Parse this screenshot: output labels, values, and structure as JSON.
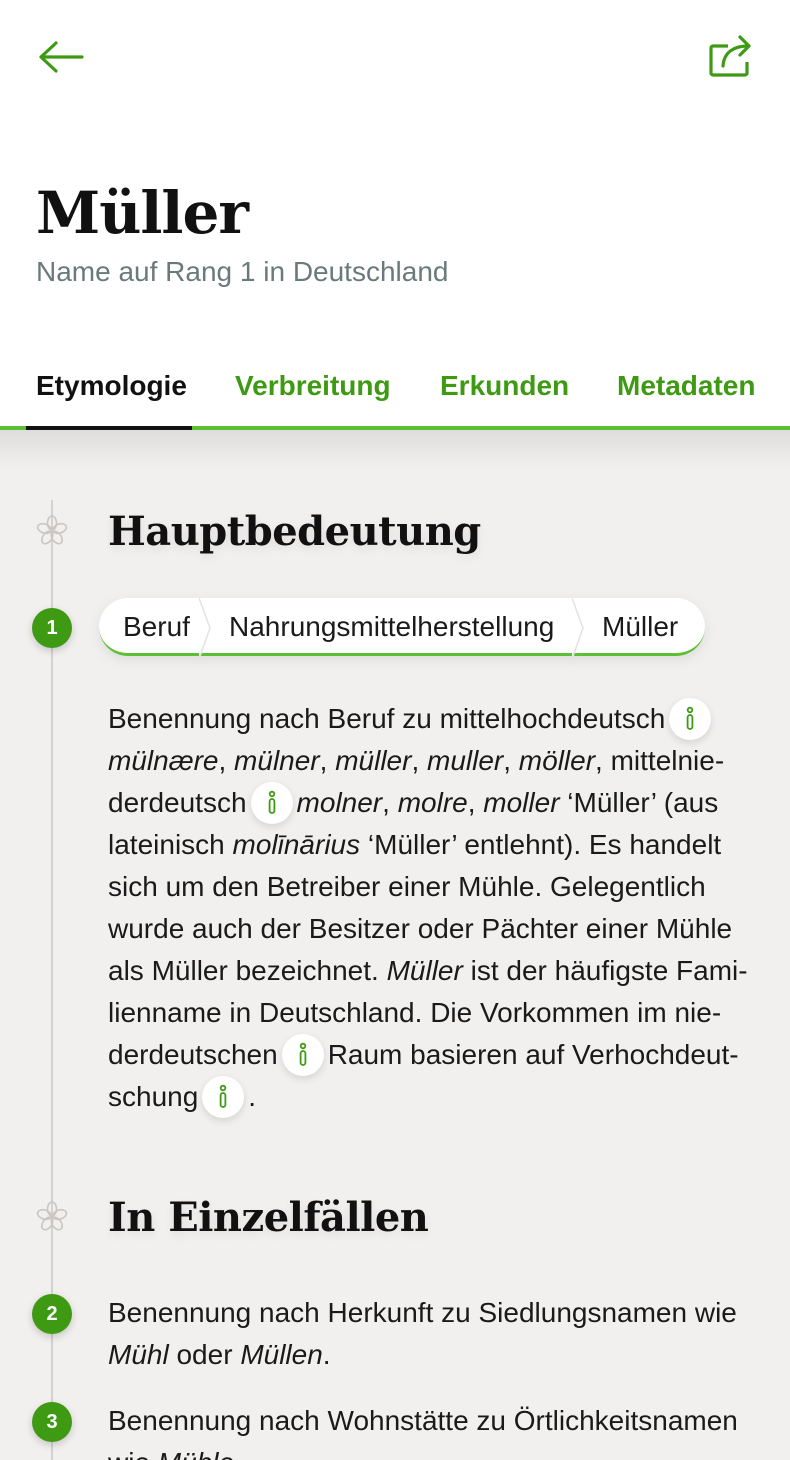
{
  "header": {
    "title": "Müller",
    "subtitle": "Name auf Rang 1 in Deutschland"
  },
  "tabs": [
    {
      "label": "Etymologie",
      "active": true
    },
    {
      "label": "Verbreitung",
      "active": false
    },
    {
      "label": "Erkunden",
      "active": false
    },
    {
      "label": "Metadaten",
      "active": false
    }
  ],
  "sections": {
    "main": {
      "heading": "Hauptbedeutung",
      "number": "1",
      "breadcrumb": [
        "Beruf",
        "Nahrungsmittelherstellung",
        "Müller"
      ],
      "text": {
        "l1": "Benennung nach Beruf zu mittelhochdeutsch",
        "l2_w1": "mülnære",
        "l2_s1": ", ",
        "l2_w2": "mülner",
        "l2_s2": ", ",
        "l2_w3": "müller",
        "l2_s3": ", ",
        "l2_w4": "muller",
        "l2_s4": ", ",
        "l2_w5": "möller",
        "l2_s5": ", mittelnie-",
        "l3_a": "derdeutsch",
        "l3_w1": "molner",
        "l3_s1": ", ",
        "l3_w2": "molre",
        "l3_s2": ", ",
        "l3_w3": "moller",
        "l3_b": " ‘Müller’ (aus",
        "l4_a": "lateinisch ",
        "l4_w": "molīnārius",
        "l4_b": " ‘Müller’ entlehnt). Es handelt",
        "l5": "sich um den Betreiber einer Mühle. Gelegentlich",
        "l6": "wurde auch der Besitzer oder Pächter einer Mühle",
        "l7_a": "als Müller bezeichnet. ",
        "l7_w": "Müller",
        "l7_b": " ist der häufigste Fami-",
        "l8": "lienname in Deutschland. Die Vorkommen im nie-",
        "l9_a": "derdeutschen",
        "l9_b": "Raum basieren auf Verhochdeut-",
        "l10_a": "schung",
        "l10_b": "."
      }
    },
    "single_cases": {
      "heading": "In Einzelfällen",
      "items": [
        {
          "number": "2",
          "l1": "Benennung nach Herkunft zu Siedlungsnamen wie",
          "l2_w1": "Mühl",
          "l2_s": " oder ",
          "l2_w2": "Müllen",
          "l2_end": "."
        },
        {
          "number": "3",
          "l1": "Benennung nach Wohnstätte zu Örtlichkeitsnamen",
          "l2_a": "wie ",
          "l2_w": "Mühle",
          "l2_end": "."
        }
      ]
    }
  },
  "icons": {
    "back": "arrow-left-icon",
    "share": "share-icon",
    "info": "info-icon",
    "section": "flower-icon"
  },
  "colors": {
    "accent": "#3d9a12",
    "accent_light": "#5bc034",
    "background": "#f2f0ef",
    "text": "#1a1a1a",
    "subtitle": "#6a7a7a"
  }
}
